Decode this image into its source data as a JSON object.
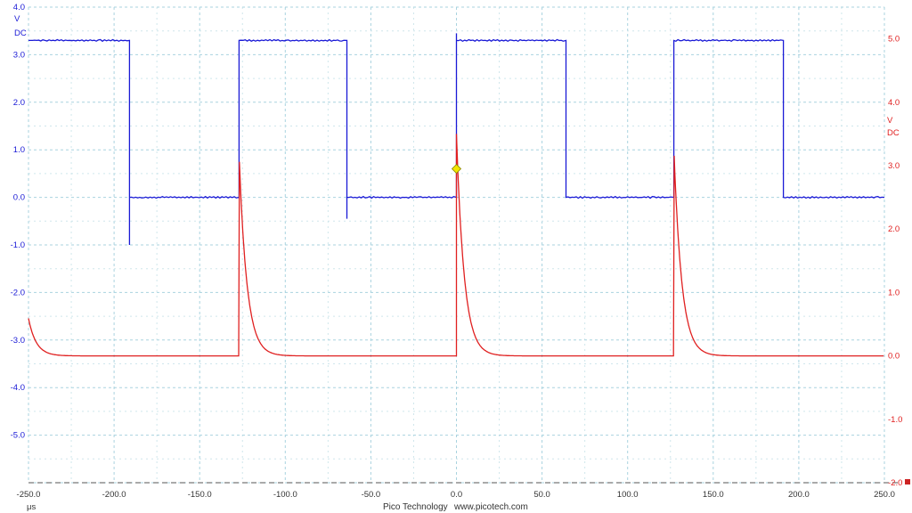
{
  "chart_data": {
    "type": "line",
    "title": "",
    "xlabel": "μs",
    "xlim": [
      -250,
      250
    ],
    "x_ticks": [
      "-250.0",
      "-200.0",
      "-150.0",
      "-100.0",
      "-50.0",
      "0.0",
      "50.0",
      "100.0",
      "150.0",
      "200.0",
      "250.0"
    ],
    "grid": true,
    "left_axis": {
      "unit": "V",
      "coupling": "DC",
      "color": "#1a1ad6",
      "ylim": [
        -6.0,
        4.0
      ],
      "ticks": [
        "4.0",
        "3.0",
        "2.0",
        "1.0",
        "0.0",
        "-1.0",
        "-2.0",
        "-3.0",
        "-4.0",
        "-5.0"
      ]
    },
    "right_axis": {
      "unit": "V",
      "coupling": "DC",
      "color": "#e02020",
      "ylim": [
        -2.0,
        5.5
      ],
      "ticks": [
        "5.0",
        "4.0",
        "3.0",
        "2.0",
        "1.0",
        "0.0",
        "-1.0",
        "-2.0"
      ]
    },
    "series": [
      {
        "axis": "left",
        "color": "#1a1ad6",
        "shape": "square",
        "low": 0.0,
        "high": 3.3,
        "edges": [
          {
            "t": -191,
            "dir": "fall",
            "spike": -1.0
          },
          {
            "t": -127,
            "dir": "rise",
            "spike": 0
          },
          {
            "t": -64,
            "dir": "fall",
            "spike": -0.45
          },
          {
            "t": 0,
            "dir": "rise",
            "spike": 3.45
          },
          {
            "t": 64,
            "dir": "fall",
            "spike": 0
          },
          {
            "t": 127,
            "dir": "rise",
            "spike": 0
          },
          {
            "t": 191,
            "dir": "fall",
            "spike": 0
          }
        ],
        "start_level": 3.3
      },
      {
        "axis": "right",
        "color": "#e02020",
        "shape": "decay-pulses",
        "baseline": 0.0,
        "tau_us": 4.5,
        "pulses": [
          {
            "t": -258,
            "peak": 3.5
          },
          {
            "t": -127,
            "peak": 3.2
          },
          {
            "t": 0,
            "peak": 3.5
          },
          {
            "t": 127,
            "peak": 3.3
          }
        ]
      }
    ],
    "trigger": {
      "t": 0,
      "value": 0.6,
      "axis": "left",
      "color": "#f2e600"
    }
  },
  "footer": {
    "brand": "Pico Technology",
    "url": "www.picotech.com"
  }
}
